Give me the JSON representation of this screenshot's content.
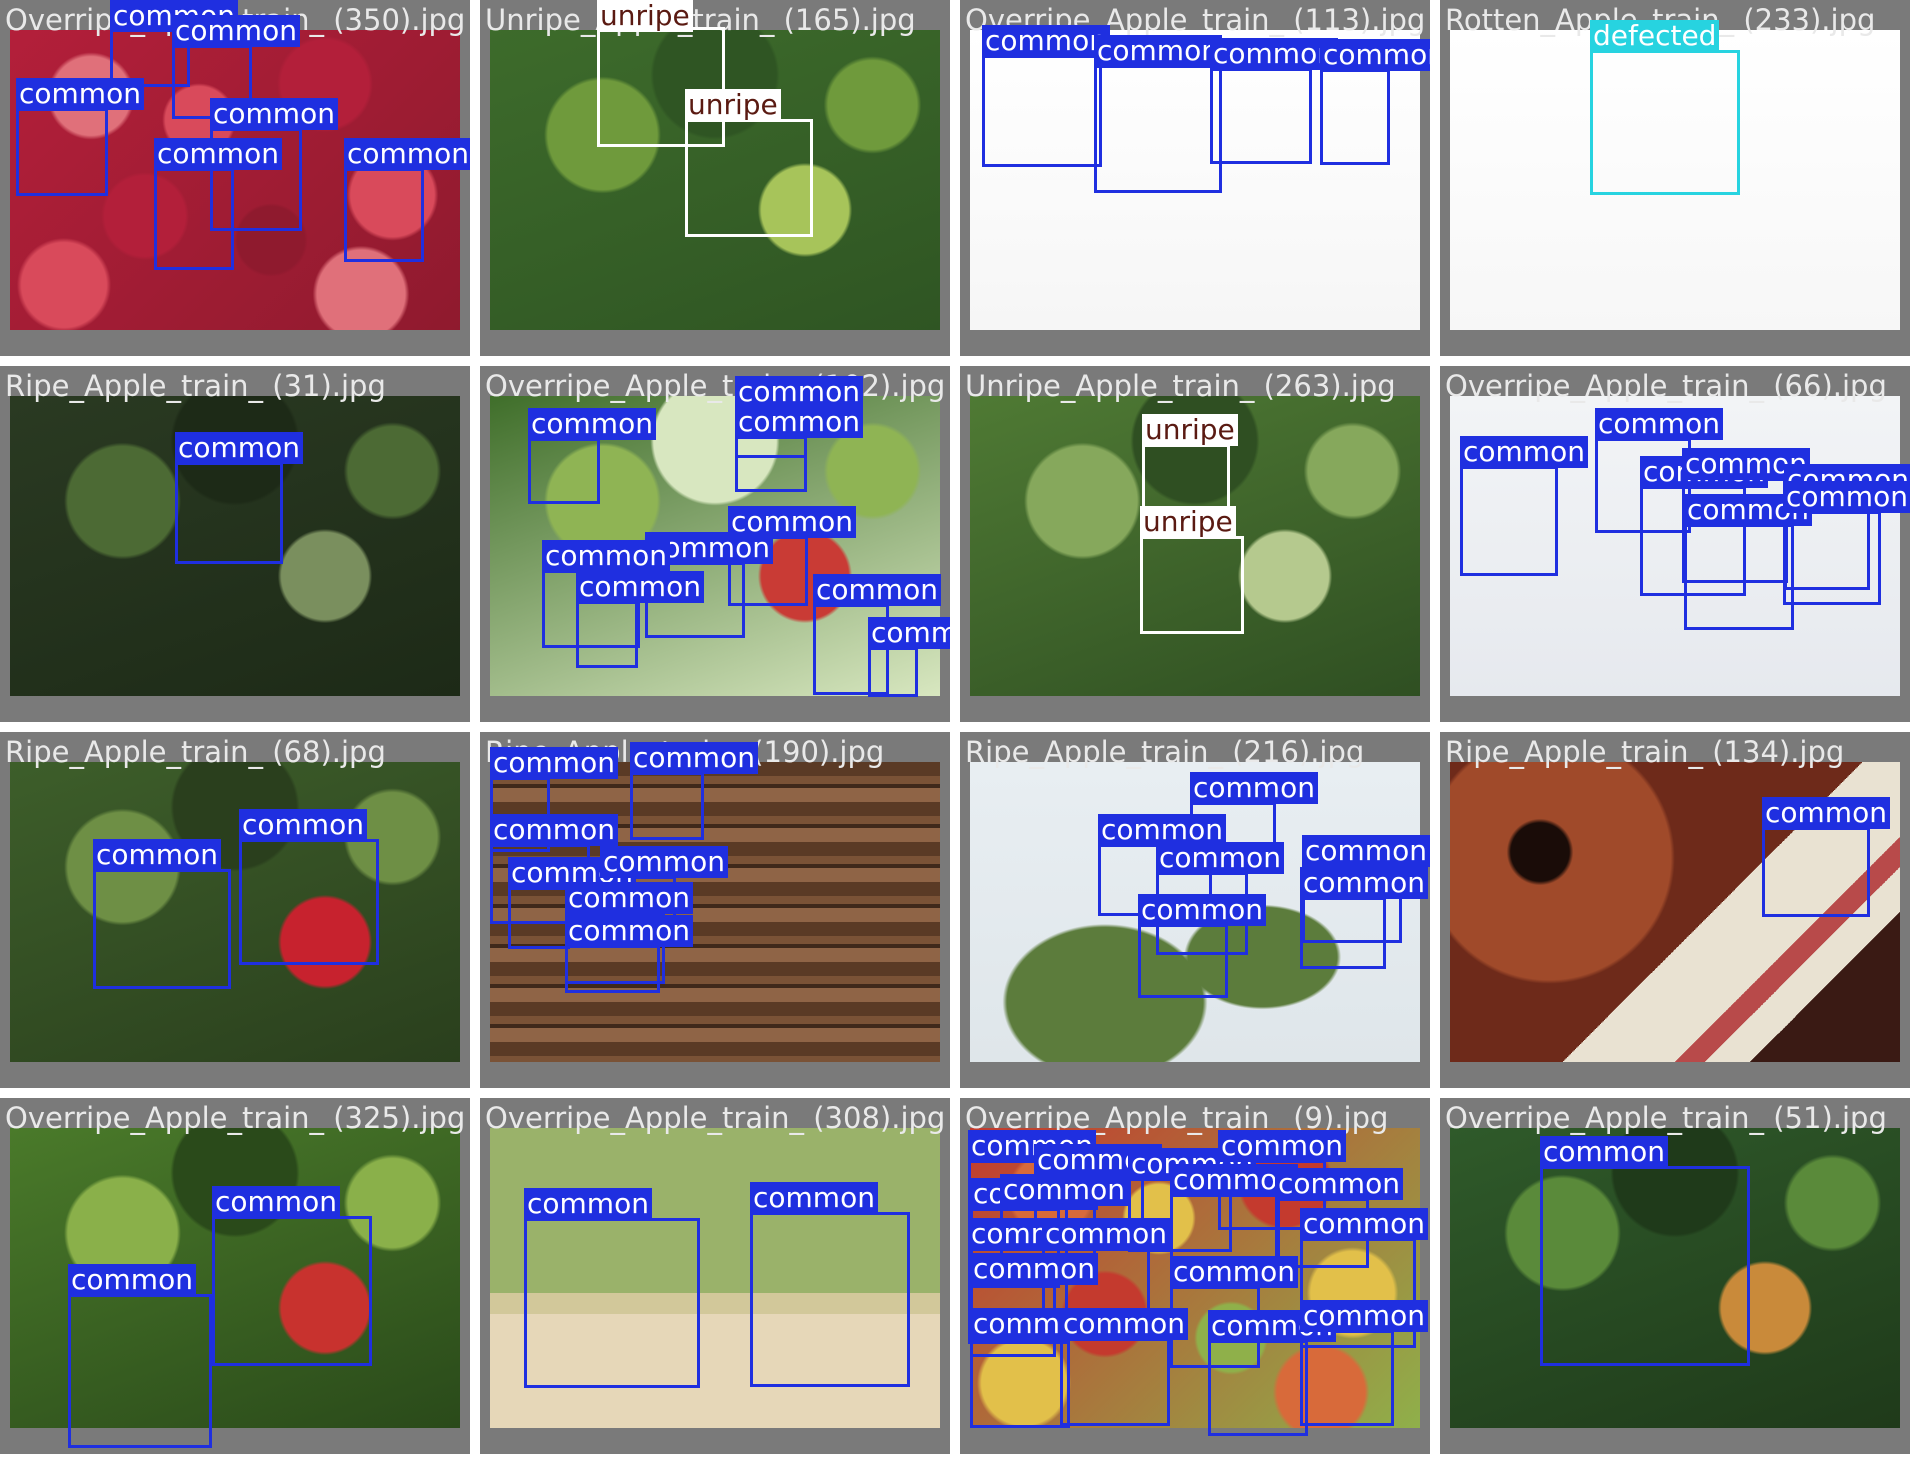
{
  "palette": {
    "common": "#1f2fe0",
    "unripe": "#ffffff",
    "defected": "#27d3e0",
    "tile_background": "#7a7a7a",
    "caption_text": "#e9e9e9"
  },
  "tiles": [
    {
      "caption": "Overripe_Apple_train_ (350).jpg",
      "scene": {
        "colors": [
          "#b31f3a",
          "#d94a5b",
          "#8f1a2e",
          "#e0707a"
        ],
        "type": "apple-pile"
      },
      "detections": [
        {
          "label": "common"
        },
        {
          "label": "common"
        },
        {
          "label": "common"
        },
        {
          "label": "common"
        },
        {
          "label": "common"
        },
        {
          "label": "common"
        }
      ]
    },
    {
      "caption": "Unripe_Apple_train_ (165).jpg",
      "scene": {
        "colors": [
          "#3d6b2b",
          "#6f9a3c",
          "#2f5523",
          "#a7c45a"
        ],
        "type": "foliage"
      },
      "detections": [
        {
          "label": "unripe"
        },
        {
          "label": "unripe"
        }
      ]
    },
    {
      "caption": "Overripe_Apple_train_ (113).jpg",
      "scene": {
        "colors": [
          "#ffffff",
          "#f6f6f6"
        ],
        "type": "white"
      },
      "detections": [
        {
          "label": "common"
        },
        {
          "label": "common"
        },
        {
          "label": "common"
        },
        {
          "label": "common"
        }
      ]
    },
    {
      "caption": "Rotten_Apple_train_ (233).jpg",
      "scene": {
        "colors": [
          "#ffffff",
          "#f7f7f7"
        ],
        "type": "white"
      },
      "detections": [
        {
          "label": "defected"
        }
      ]
    },
    {
      "caption": "Ripe_Apple_train_ (31).jpg",
      "scene": {
        "colors": [
          "#2a3a22",
          "#4c6a34",
          "#1d2a17",
          "#7a8f5e"
        ],
        "type": "foliage"
      },
      "detections": [
        {
          "label": "common"
        }
      ]
    },
    {
      "caption": "Overripe_Apple_train_ (102).jpg",
      "scene": {
        "colors": [
          "#3f6e2a",
          "#8fb454",
          "#d8e7c0",
          "#c93b35"
        ],
        "type": "foliage"
      },
      "detections": [
        {
          "label": "common"
        },
        {
          "label": "common"
        },
        {
          "label": "common"
        },
        {
          "label": "common"
        },
        {
          "label": "common"
        },
        {
          "label": "common"
        },
        {
          "label": "common"
        },
        {
          "label": "common"
        },
        {
          "label": "common"
        }
      ]
    },
    {
      "caption": "Unripe_Apple_train_ (263).jpg",
      "scene": {
        "colors": [
          "#4f7a34",
          "#86a85c",
          "#2f4f22",
          "#b5c98e"
        ],
        "type": "foliage"
      },
      "detections": [
        {
          "label": "unripe"
        },
        {
          "label": "unripe"
        }
      ]
    },
    {
      "caption": "Overripe_Apple_train_ (66).jpg",
      "scene": {
        "colors": [
          "#f2f4f6",
          "#e6e9ee",
          "#ffffff"
        ],
        "type": "white"
      },
      "detections": [
        {
          "label": "common"
        },
        {
          "label": "common"
        },
        {
          "label": "common"
        },
        {
          "label": "common"
        },
        {
          "label": "common"
        },
        {
          "label": "common"
        },
        {
          "label": "common"
        }
      ]
    },
    {
      "caption": "Ripe_Apple_train_ (68).jpg",
      "scene": {
        "colors": [
          "#3d5e2a",
          "#6e8f45",
          "#2a3f1d",
          "#c7222e"
        ],
        "type": "foliage"
      },
      "detections": [
        {
          "label": "common"
        },
        {
          "label": "common"
        }
      ]
    },
    {
      "caption": "Ripe_Apple_train_ (190).jpg",
      "scene": {
        "colors": [
          "#5a3a25",
          "#7a5236",
          "#3f281a",
          "#8f6446"
        ],
        "type": "wood"
      },
      "detections": [
        {
          "label": "common"
        },
        {
          "label": "common"
        },
        {
          "label": "common"
        },
        {
          "label": "common"
        },
        {
          "label": "common"
        },
        {
          "label": "common"
        },
        {
          "label": "common"
        }
      ]
    },
    {
      "caption": "Ripe_Apple_train_ (216).jpg",
      "scene": {
        "colors": [
          "#e8eef2",
          "#dfe6ea",
          "#5c7c3c",
          "#b6223a"
        ],
        "type": "sky"
      },
      "detections": [
        {
          "label": "common"
        },
        {
          "label": "common"
        },
        {
          "label": "common"
        },
        {
          "label": "common"
        },
        {
          "label": "common"
        },
        {
          "label": "common"
        }
      ]
    },
    {
      "caption": "Ripe_Apple_train_ (134).jpg",
      "scene": {
        "colors": [
          "#6e2a1a",
          "#a04a2a",
          "#e9e2d2",
          "#b62a3a"
        ],
        "type": "cake"
      },
      "detections": [
        {
          "label": "common"
        }
      ]
    },
    {
      "caption": "Overripe_Apple_train_ (325).jpg",
      "scene": {
        "colors": [
          "#4a7a2a",
          "#8ab04a",
          "#2a4a1a",
          "#c8322e"
        ],
        "type": "foliage"
      },
      "detections": [
        {
          "label": "common"
        },
        {
          "label": "common"
        }
      ]
    },
    {
      "caption": "Overripe_Apple_train_ (308).jpg",
      "scene": {
        "colors": [
          "#9ab26a",
          "#d2c89a",
          "#e6d7b8",
          "#d1542a"
        ],
        "type": "table"
      },
      "detections": [
        {
          "label": "common"
        },
        {
          "label": "common"
        }
      ]
    },
    {
      "caption": "Overripe_Apple_train_ (9).jpg",
      "scene": {
        "colors": [
          "#c43a2e",
          "#e2c04a",
          "#8fb04a",
          "#d86a3a"
        ],
        "type": "apple-pile"
      },
      "detections": [
        {
          "label": "common"
        },
        {
          "label": "common"
        },
        {
          "label": "common"
        },
        {
          "label": "common"
        },
        {
          "label": "common"
        },
        {
          "label": "common"
        },
        {
          "label": "common"
        },
        {
          "label": "common"
        },
        {
          "label": "common"
        },
        {
          "label": "common"
        },
        {
          "label": "common"
        },
        {
          "label": "common"
        },
        {
          "label": "common"
        },
        {
          "label": "common"
        },
        {
          "label": "common"
        },
        {
          "label": "common"
        },
        {
          "label": "common"
        }
      ]
    },
    {
      "caption": "Overripe_Apple_train_ (51).jpg",
      "scene": {
        "colors": [
          "#2f5a2a",
          "#5a8a3a",
          "#1f3a1a",
          "#c98a3a"
        ],
        "type": "foliage"
      },
      "detections": [
        {
          "label": "common"
        }
      ]
    }
  ]
}
